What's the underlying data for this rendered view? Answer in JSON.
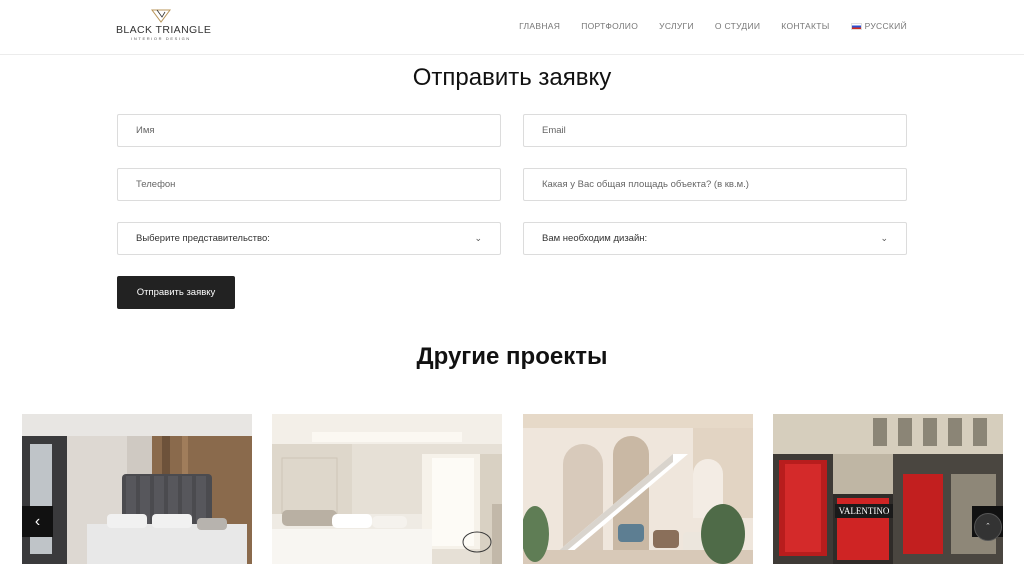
{
  "header": {
    "logo_name": "BLACK TRIANGLE",
    "logo_sub": "INTERIOR DESIGN",
    "nav": [
      "ГЛАВНАЯ",
      "ПОРТФОЛИО",
      "УСЛУГИ",
      "О СТУДИИ",
      "КОНТАКТЫ"
    ],
    "language": "РУССКИЙ"
  },
  "form": {
    "title": "Отправить заявку",
    "name_placeholder": "Имя",
    "email_placeholder": "Email",
    "phone_placeholder": "Телефон",
    "area_placeholder": "Какая у Вас общая площадь объекта? (в кв.м.)",
    "office_select": "Выберите представительство:",
    "design_select": "Вам необходим дизайн:",
    "submit_label": "Отправить заявку"
  },
  "projects": {
    "title": "Другие проекты",
    "card4_sign": "VALENTINO"
  },
  "controls": {
    "prev_label": "‹",
    "to_top_label": "ˆ"
  },
  "colors": {
    "button_bg": "#222222",
    "field_border": "#dcdcdc",
    "logo_gold": "#b8955a"
  }
}
